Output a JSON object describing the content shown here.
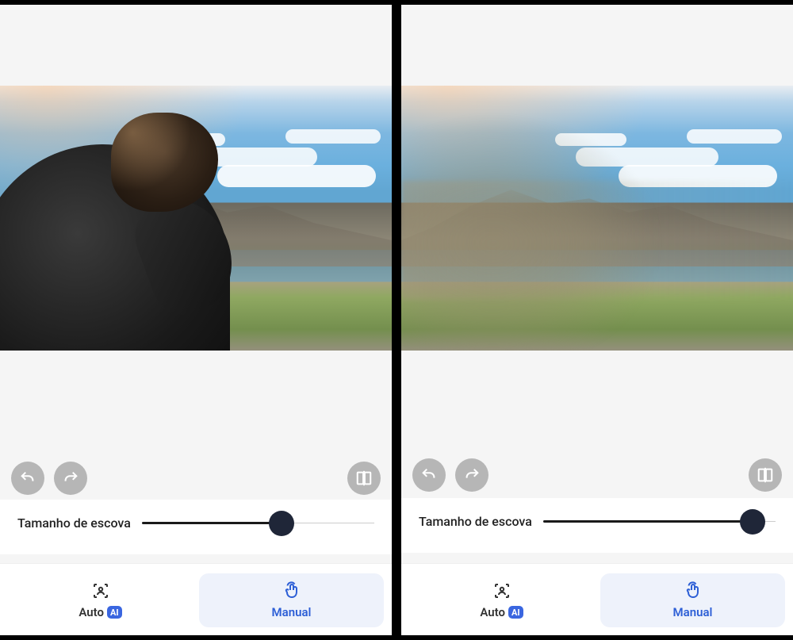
{
  "left": {
    "slider_label": "Tamanho de escova",
    "slider_value_pct": 60,
    "tabs": {
      "auto_label": "Auto",
      "auto_badge": "AI",
      "manual_label": "Manual",
      "active": "manual"
    },
    "icons": {
      "undo": "undo-icon",
      "redo": "redo-icon",
      "compare": "compare-icon",
      "auto_tab": "scan-person-icon",
      "manual_tab": "touch-icon"
    }
  },
  "right": {
    "slider_label": "Tamanho de escova",
    "slider_value_pct": 90,
    "tabs": {
      "auto_label": "Auto",
      "auto_badge": "AI",
      "manual_label": "Manual",
      "active": "manual"
    },
    "icons": {
      "undo": "undo-icon",
      "redo": "redo-icon",
      "compare": "compare-icon",
      "auto_tab": "scan-person-icon",
      "manual_tab": "touch-icon"
    }
  }
}
